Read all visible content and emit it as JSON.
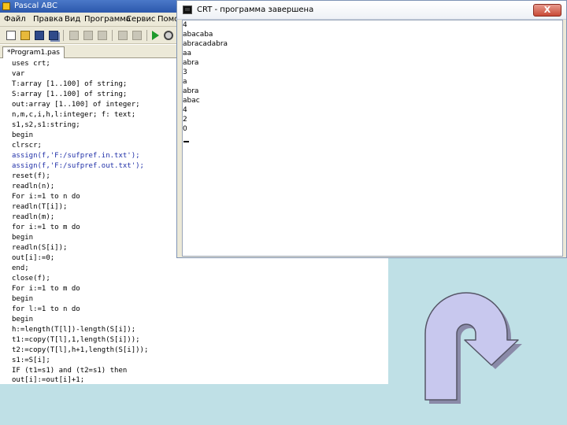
{
  "ide": {
    "title": "Pascal ABC",
    "menu": [
      "Файл",
      "Правка",
      "Вид",
      "Программа",
      "Сервис",
      "Помощь"
    ],
    "tab_label": "*Program1.pas",
    "code_lines": [
      "uses crt;",
      "var",
      "T:array [1..100] of string;",
      "S:array [1..100] of string;",
      "out:array [1..100] of integer;",
      "n,m,c,i,h,l:integer; f: text;",
      "s1,s2,s1:string;",
      "begin",
      "clrscr;",
      "assign(f,'F:/sufpref.in.txt');",
      "assign(f,'F:/sufpref.out.txt');",
      "reset(f);",
      "readln(n);",
      "For i:=1 to n do",
      "readln(T[i]);",
      "readln(m);",
      "for i:=1 to m do",
      "begin",
      "readln(S[i]);",
      "out[i]:=0;",
      "end;",
      "close(f);",
      "For i:=1 to m do",
      "begin",
      "for l:=1 to n do",
      "begin",
      "h:=length(T[l])-length(S[i]);",
      "t1:=copy(T[l],1,length(S[i]));",
      "t2:=copy(T[l],h+1,length(S[i]));",
      "s1:=S[i];",
      "IF (t1=s1) and (t2=s1) then",
      "out[i]:=out[i]+1;"
    ]
  },
  "crt": {
    "icon": "console-window-icon",
    "title": "CRT - программа завершена",
    "close_label": "X",
    "output_lines": [
      "4",
      "abacaba",
      "abracadabra",
      "aa",
      "abra",
      "3",
      "a",
      "abra",
      "abac",
      "4",
      "2",
      "0"
    ]
  },
  "decoration": {
    "icon": "u-turn-arrow-icon",
    "fill": "#c8c8ee",
    "outline": "#555566",
    "shadow": "#8a8aa8"
  }
}
